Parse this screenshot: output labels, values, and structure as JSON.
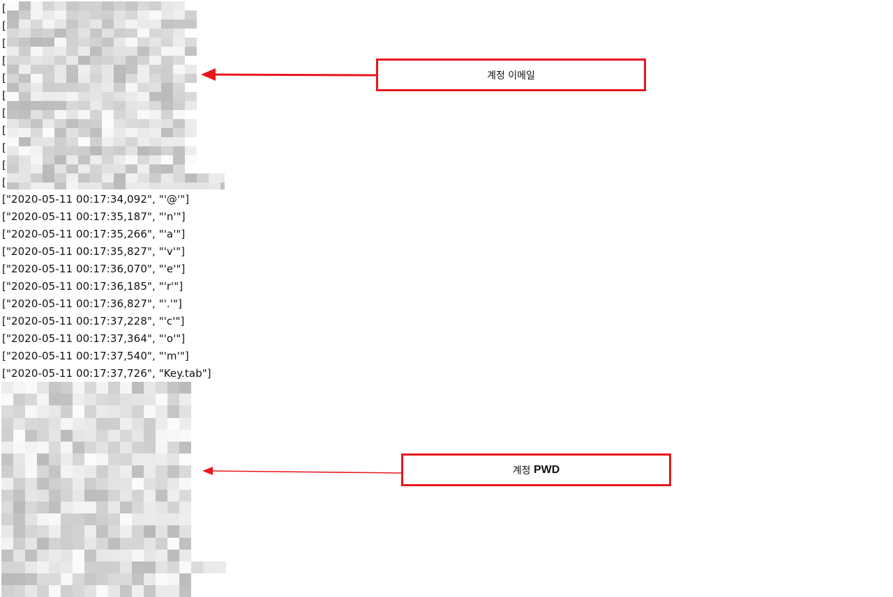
{
  "email_log": [
    "[\"2020-05-11 00:17:34,092\", \"'@'\"]",
    "[\"2020-05-11 00:17:35,187\", \"'n'\"]",
    "[\"2020-05-11 00:17:35,266\", \"'a'\"]",
    "[\"2020-05-11 00:17:35,827\", \"'v'\"]",
    "[\"2020-05-11 00:17:36,070\", \"'e'\"]",
    "[\"2020-05-11 00:17:36,185\", \"'r'\"]",
    "[\"2020-05-11 00:17:36,827\", \"'.'\"]",
    "[\"2020-05-11 00:17:37,228\", \"'c'\"]",
    "[\"2020-05-11 00:17:37,364\", \"'o'\"]",
    "[\"2020-05-11 00:17:37,540\", \"'m'\"]",
    "[\"2020-05-11 00:17:37,726\", \"Key.tab\"]"
  ],
  "bracket_char": "[",
  "callouts": {
    "email": {
      "prefix": "계정 이메일",
      "suffix": ""
    },
    "password": {
      "prefix": "계정 ",
      "suffix": "PWD"
    }
  },
  "colors": {
    "accent": "#e8161c",
    "redacted_light": "#ececec",
    "redacted_dark": "#b9b9b9"
  }
}
